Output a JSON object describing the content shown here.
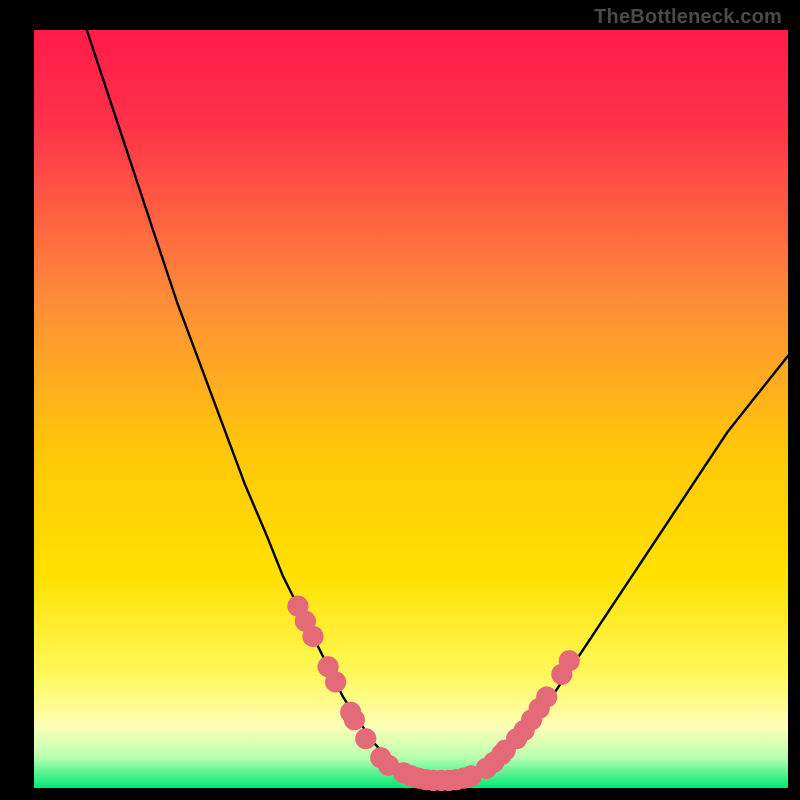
{
  "watermark": "TheBottleneck.com",
  "chart_data": {
    "type": "line",
    "title": "",
    "xlabel": "",
    "ylabel": "",
    "xlim": [
      0,
      100
    ],
    "ylim": [
      0,
      100
    ],
    "grid": false,
    "legend": false,
    "background_gradient_top": "#ff1e45",
    "background_gradient_mid": "#ffd400",
    "background_gradient_bottom": "#00e874",
    "frame_color": "#000000",
    "curve_color": "#000000",
    "marker_color": "#e46a77",
    "marker_radius": 1.4,
    "series": [
      {
        "name": "bottleneck-curve",
        "x": [
          7,
          10,
          13,
          16,
          19,
          22,
          25,
          28,
          31,
          33,
          35,
          37,
          39,
          41,
          43,
          45,
          47,
          49,
          51,
          53,
          55,
          57,
          60,
          64,
          68,
          72,
          76,
          80,
          84,
          88,
          92,
          96,
          100
        ],
        "y": [
          100,
          91,
          82,
          73,
          64,
          56,
          48,
          40,
          33,
          28,
          24,
          20,
          16,
          12,
          9,
          6,
          4,
          2.2,
          1.2,
          1,
          1,
          1.2,
          2.5,
          6,
          11,
          17,
          23,
          29,
          35,
          41,
          47,
          52,
          57
        ]
      }
    ],
    "markers": {
      "comment": "salmon dots clustered along the curve near the trough, plotted in data-space",
      "points": [
        [
          35,
          24
        ],
        [
          36,
          22
        ],
        [
          37,
          20
        ],
        [
          39,
          16
        ],
        [
          40,
          14
        ],
        [
          42,
          10
        ],
        [
          42.5,
          9
        ],
        [
          44,
          6.5
        ],
        [
          46,
          4
        ],
        [
          47,
          3
        ],
        [
          49,
          2
        ],
        [
          50,
          1.6
        ],
        [
          51,
          1.3
        ],
        [
          52,
          1.1
        ],
        [
          53,
          1
        ],
        [
          54,
          1
        ],
        [
          55,
          1
        ],
        [
          56,
          1.1
        ],
        [
          57,
          1.3
        ],
        [
          58,
          1.6
        ],
        [
          60,
          2.6
        ],
        [
          61,
          3.4
        ],
        [
          62,
          4.4
        ],
        [
          62.5,
          5
        ],
        [
          64,
          6.5
        ],
        [
          65,
          7.6
        ],
        [
          66,
          9
        ],
        [
          67,
          10.5
        ],
        [
          68,
          12
        ],
        [
          70,
          15
        ],
        [
          71,
          16.8
        ]
      ]
    }
  }
}
